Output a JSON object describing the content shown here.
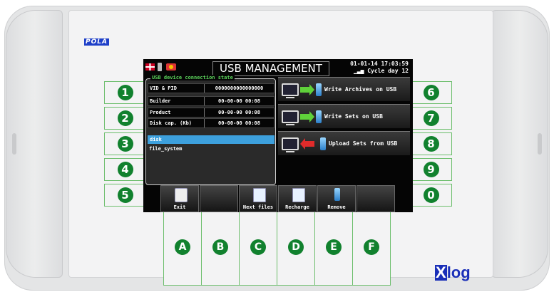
{
  "brand": "POLA",
  "logo": {
    "mark": "X",
    "text": "log"
  },
  "screen": {
    "title": "USB MANAGEMENT",
    "date_time": "01-01-14  17:03:59",
    "cycle": "Cycle day 12",
    "usb_state": {
      "legend": "USB device connection state",
      "rows": [
        {
          "key": "VID & PID",
          "value": "0000000000000000"
        },
        {
          "key": "Builder",
          "value": "00-00-00 00:08"
        },
        {
          "key": "Product",
          "value": "00-00-00 00:08"
        },
        {
          "key": "Disk cap. (Kb)",
          "value": "00-00-00 00:08"
        }
      ],
      "selected": "disk",
      "file_system": "file_system"
    },
    "actions": [
      "Write Archives on USB",
      "Write Sets on USB",
      "Upload Sets from USB"
    ],
    "fkeys": [
      {
        "label": "Exit",
        "icon": "floppy-exit-icon"
      },
      {
        "label": "",
        "icon": ""
      },
      {
        "label": "Next files",
        "icon": "next-files-icon"
      },
      {
        "label": "Recharge",
        "icon": "recharge-icon"
      },
      {
        "label": "Remove",
        "icon": "usb-remove-icon"
      },
      {
        "label": "",
        "icon": ""
      }
    ]
  },
  "left_keys": [
    "1",
    "2",
    "3",
    "4",
    "5"
  ],
  "right_keys": [
    "6",
    "7",
    "8",
    "9",
    "0"
  ],
  "bottom_keys": [
    "A",
    "B",
    "C",
    "D",
    "E",
    "F"
  ],
  "colors": {
    "key_green": "#11812e",
    "selected_row": "#3da0dd",
    "brand_blue": "#1a2fb8"
  }
}
